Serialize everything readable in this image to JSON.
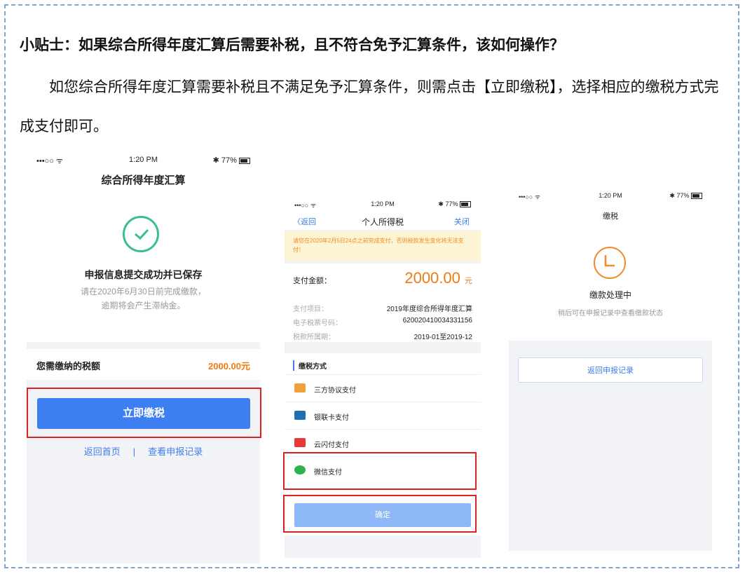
{
  "tip": {
    "title": "小贴士：如果综合所得年度汇算后需要补税，且不符合免予汇算条件，该如何操作？",
    "body": "如您综合所得年度汇算需要补税且不满足免予汇算条件，则需点击【立即缴税】，选择相应的缴税方式完成支付即可。"
  },
  "status": {
    "signal": "•••○○ ᯤ",
    "time": "1:20 PM",
    "battery": "✱ 77%"
  },
  "phone1": {
    "header": "综合所得年度汇算",
    "success": "申报信息提交成功并已保存",
    "note_line1": "请在2020年6月30日前完成缴款，",
    "note_line2": "逾期将会产生滞纳金。",
    "amount_label": "您需缴纳的税额",
    "amount_value": "2000.00元",
    "pay_button": "立即缴税",
    "link_home": "返回首页",
    "link_sep": "|",
    "link_records": "查看申报记录"
  },
  "phone2": {
    "back": "〈返回",
    "title": "个人所得税",
    "close": "关闭",
    "warning": "请您在2020年2月5日24点之前完成支付，否则税款发生变化将无法支付！",
    "pay_label": "支付金额：",
    "pay_amount": "2000.00",
    "pay_unit": "元",
    "rows": [
      {
        "k": "支付项目：",
        "v": "2019年度综合所得年度汇算"
      },
      {
        "k": "电子税票号码：",
        "v": "620020410034331156"
      },
      {
        "k": "税款所属期：",
        "v": "2019-01至2019-12"
      }
    ],
    "methods_title": "缴税方式",
    "methods": [
      {
        "name": "三方协议支付",
        "icon": "pencil-icon",
        "color": "#f0a23a"
      },
      {
        "name": "银联卡支付",
        "icon": "unionpay-icon",
        "color": "#1f6fb5"
      },
      {
        "name": "云闪付支付",
        "icon": "quickpass-icon",
        "color": "#e5393a"
      },
      {
        "name": "微信支付",
        "icon": "wechat-icon",
        "color": "#2fb24c"
      }
    ],
    "confirm": "确定"
  },
  "phone3": {
    "title": "缴税",
    "processing": "缴款处理中",
    "hint": "稍后可在申报记录中查看缴款状态",
    "return_button": "返回申报记录"
  },
  "colors": {
    "accent": "#3d7ef0",
    "highlight": "#e02020",
    "amount": "#f07a12",
    "success": "#3bbf8a"
  }
}
